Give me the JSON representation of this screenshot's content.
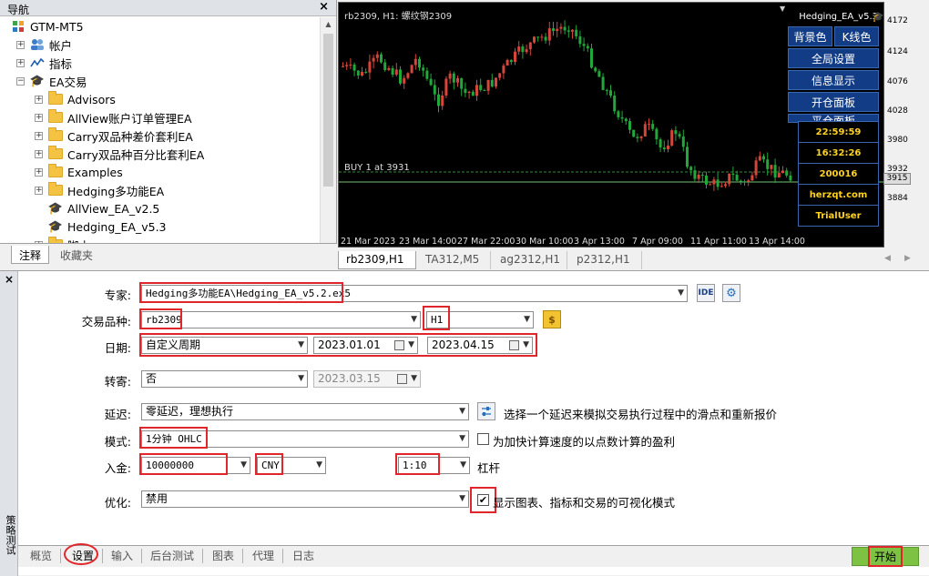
{
  "navigator": {
    "title": "导航",
    "close": "×",
    "items": [
      {
        "label": "GTM-MT5"
      },
      {
        "label": "帐户"
      },
      {
        "label": "指标"
      },
      {
        "label": "EA交易"
      },
      {
        "label": "Advisors"
      },
      {
        "label": "AllView账户订单管理EA"
      },
      {
        "label": "Carry双品种差价套利EA"
      },
      {
        "label": "Carry双品种百分比套利EA"
      },
      {
        "label": "Examples"
      },
      {
        "label": "Hedging多功能EA"
      },
      {
        "label": "AllView_EA_v2.5"
      },
      {
        "label": "Hedging_EA_v5.3"
      },
      {
        "label": "脚本"
      }
    ],
    "tabs": [
      "注释",
      "收藏夹"
    ]
  },
  "chart": {
    "title": "rb2309, H1:  螺纹钢2309",
    "ea_name": "Hedging_EA_v5.3",
    "buttons": [
      "背景色",
      "K线色",
      "全局设置",
      "信息显示",
      "开仓面板",
      "平仓面板"
    ],
    "info": [
      "22:59:59",
      "16:32:26",
      "200016",
      "herzqt.com",
      "TrialUser"
    ],
    "buy_label": "BUY 1 at 3931",
    "price_ticks": [
      "4172",
      "4124",
      "4076",
      "4028",
      "3980",
      "3932",
      "3884"
    ],
    "current_price": "3915",
    "date_ticks": [
      "21 Mar 2023",
      "23 Mar 14:00",
      "27 Mar 22:00",
      "30 Mar 10:00",
      "3 Apr 13:00",
      "7 Apr 09:00",
      "11 Apr 11:00",
      "13 Apr 14:00"
    ],
    "tabs": [
      "rb2309,H1",
      "TA312,M5",
      "ag2312,H1",
      "p2312,H1"
    ]
  },
  "tester": {
    "side_title": "策略测试",
    "close": "×",
    "expert_label": "专家:",
    "expert_value": "Hedging多功能EA\\Hedging_EA_v5.2.ex5",
    "ide_label": "IDE",
    "symbol_label": "交易品种:",
    "symbol_value": "rb2309",
    "timeframe_value": "H1",
    "date_label": "日期:",
    "period_value": "自定义周期",
    "date_from": "2023.01.01",
    "date_to": "2023.04.15",
    "forward_label": "转寄:",
    "forward_value": "否",
    "forward_date": "2023.03.15",
    "delay_label": "延迟:",
    "delay_value": "零延迟，理想执行",
    "delay_hint": "选择一个延迟来模拟交易执行过程中的滑点和重新报价",
    "mode_label": "模式:",
    "mode_value": "1分钟 OHLC",
    "mode_check_label": "为加快计算速度的以点数计算的盈利",
    "deposit_label": "入金:",
    "deposit_value": "10000000",
    "currency_value": "CNY",
    "leverage_value": "1:10",
    "leverage_label": "杠杆",
    "optim_label": "优化:",
    "optim_value": "禁用",
    "visual_label": "显示图表、指标和交易的可视化模式",
    "tabs": [
      "概览",
      "设置",
      "输入",
      "后台测试",
      "图表",
      "代理",
      "日志"
    ],
    "start": "开始"
  }
}
